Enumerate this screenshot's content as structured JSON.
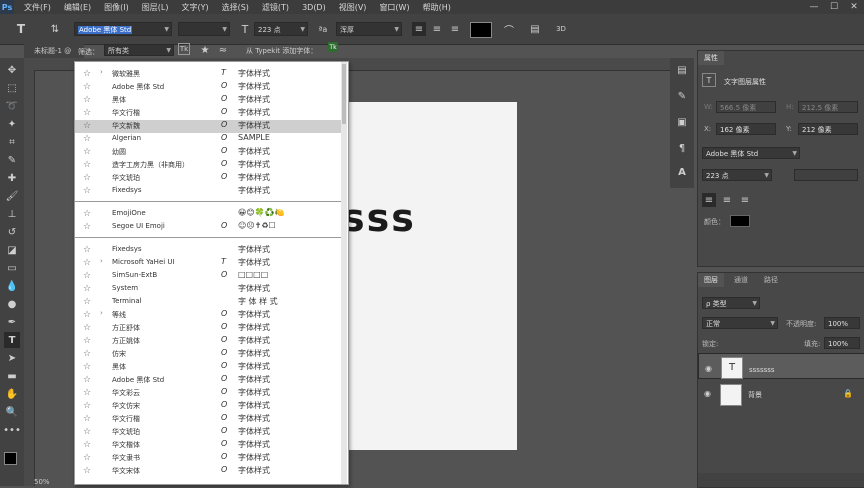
{
  "app": {
    "logo": "Ps"
  },
  "menu": [
    "文件(F)",
    "编辑(E)",
    "图像(I)",
    "图层(L)",
    "文字(Y)",
    "选择(S)",
    "滤镜(T)",
    "3D(D)",
    "视图(V)",
    "窗口(W)",
    "帮助(H)"
  ],
  "window_controls": {
    "minimize": "—",
    "maximize": "☐",
    "close": "✕"
  },
  "options": {
    "font_family": "Adobe 黑体 Std",
    "font_size": "223 点",
    "antialias": "浑厚",
    "mode_3d": "3D"
  },
  "filter_bar": {
    "label": "筛选：",
    "value": "所有类",
    "typekit": "从 Typekit 添加字体："
  },
  "document_tab": {
    "title": "未标题-1 @"
  },
  "canvas_text": "sss",
  "font_list": {
    "group1": [
      {
        "name": "微软雅黑",
        "type": "T",
        "preview": "字体样式",
        "expand": "›",
        "highlight": false
      },
      {
        "name": "Adobe 黑体 Std",
        "type": "O",
        "preview": "字体样式",
        "expand": "",
        "highlight": false
      },
      {
        "name": "黑体",
        "type": "O",
        "preview": "字体样式",
        "expand": "",
        "highlight": false
      },
      {
        "name": "华文行楷",
        "type": "O",
        "preview": "字体样式",
        "expand": "",
        "highlight": false
      },
      {
        "name": "华文新魏",
        "type": "O",
        "preview": "字体样式",
        "expand": "",
        "highlight": true
      },
      {
        "name": "Algerian",
        "type": "O",
        "preview": "SAMPLE",
        "expand": "",
        "highlight": false
      },
      {
        "name": "幼圆",
        "type": "O",
        "preview": "字体样式",
        "expand": "",
        "highlight": false
      },
      {
        "name": "造字工房力黑（非商用）",
        "type": "O",
        "preview": "字体样式",
        "expand": "",
        "highlight": false
      },
      {
        "name": "华文琥珀",
        "type": "O",
        "preview": "字体样式",
        "expand": "",
        "highlight": false
      },
      {
        "name": "Fixedsys",
        "type": "",
        "preview": "字体样式",
        "expand": "",
        "highlight": false
      }
    ],
    "group2": [
      {
        "name": "EmojiOne",
        "type": "",
        "preview": "😀😊🍀♻️🍋",
        "expand": "",
        "highlight": false
      },
      {
        "name": "Segoe UI Emoji",
        "type": "O",
        "preview": "☺☹✝♻☐",
        "expand": "",
        "highlight": false
      }
    ],
    "group3": [
      {
        "name": "Fixedsys",
        "type": "",
        "preview": "字体样式",
        "expand": "",
        "highlight": false
      },
      {
        "name": "Microsoft YaHei UI",
        "type": "T",
        "preview": "字体样式",
        "expand": "›",
        "highlight": false
      },
      {
        "name": "SimSun-ExtB",
        "type": "O",
        "preview": "□□□□",
        "expand": "",
        "highlight": false
      },
      {
        "name": "System",
        "type": "",
        "preview": "字体样式",
        "expand": "",
        "highlight": false
      },
      {
        "name": "Terminal",
        "type": "",
        "preview": "字 体 样 式",
        "expand": "",
        "highlight": false
      },
      {
        "name": "等线",
        "type": "O",
        "preview": "字体样式",
        "expand": "›",
        "highlight": false
      },
      {
        "name": "方正舒体",
        "type": "O",
        "preview": "字体样式",
        "expand": "",
        "highlight": false
      },
      {
        "name": "方正姚体",
        "type": "O",
        "preview": "字体样式",
        "expand": "",
        "highlight": false
      },
      {
        "name": "仿宋",
        "type": "O",
        "preview": "字体样式",
        "expand": "",
        "highlight": false
      },
      {
        "name": "黑体",
        "type": "O",
        "preview": "字体样式",
        "expand": "",
        "highlight": false
      },
      {
        "name": "Adobe 黑体 Std",
        "type": "O",
        "preview": "字体样式",
        "expand": "",
        "highlight": false
      },
      {
        "name": "华文彩云",
        "type": "O",
        "preview": "字体样式",
        "expand": "",
        "highlight": false
      },
      {
        "name": "华文仿宋",
        "type": "O",
        "preview": "字体样式",
        "expand": "",
        "highlight": false
      },
      {
        "name": "华文行楷",
        "type": "O",
        "preview": "字体样式",
        "expand": "",
        "highlight": false
      },
      {
        "name": "华文琥珀",
        "type": "O",
        "preview": "字体样式",
        "expand": "",
        "highlight": false
      },
      {
        "name": "华文楷体",
        "type": "O",
        "preview": "字体样式",
        "expand": "",
        "highlight": false
      },
      {
        "name": "华文隶书",
        "type": "O",
        "preview": "字体样式",
        "expand": "",
        "highlight": false
      },
      {
        "name": "华文宋体",
        "type": "O",
        "preview": "字体样式",
        "expand": "",
        "highlight": false
      }
    ]
  },
  "properties": {
    "tab": "属性",
    "header": "文字图层属性",
    "w_label": "W:",
    "w_value": "566.5 像素",
    "h_label": "H:",
    "h_value": "212.5 像素",
    "x_label": "X:",
    "x_value": "162 像素",
    "y_label": "Y:",
    "y_value": "212 像素",
    "font": "Adobe 黑体 Std",
    "size": "223 点",
    "color_label": "颜色："
  },
  "layers": {
    "tabs": [
      "图层",
      "通道",
      "路径"
    ],
    "kind_filter": "ρ 类型",
    "blend_mode": "正常",
    "opacity_label": "不透明度:",
    "opacity_value": "100%",
    "lock_label": "锁定:",
    "fill_label": "填充:",
    "fill_value": "100%",
    "items": [
      {
        "name": "sssssss",
        "thumb": "T",
        "selected": true,
        "locked": false
      },
      {
        "name": "背景",
        "thumb": "",
        "selected": false,
        "locked": true
      }
    ]
  },
  "zoom": "50%",
  "colors": {
    "foreground": "#000000",
    "background": "#ffffff",
    "text_color": "#1b1b1b"
  }
}
